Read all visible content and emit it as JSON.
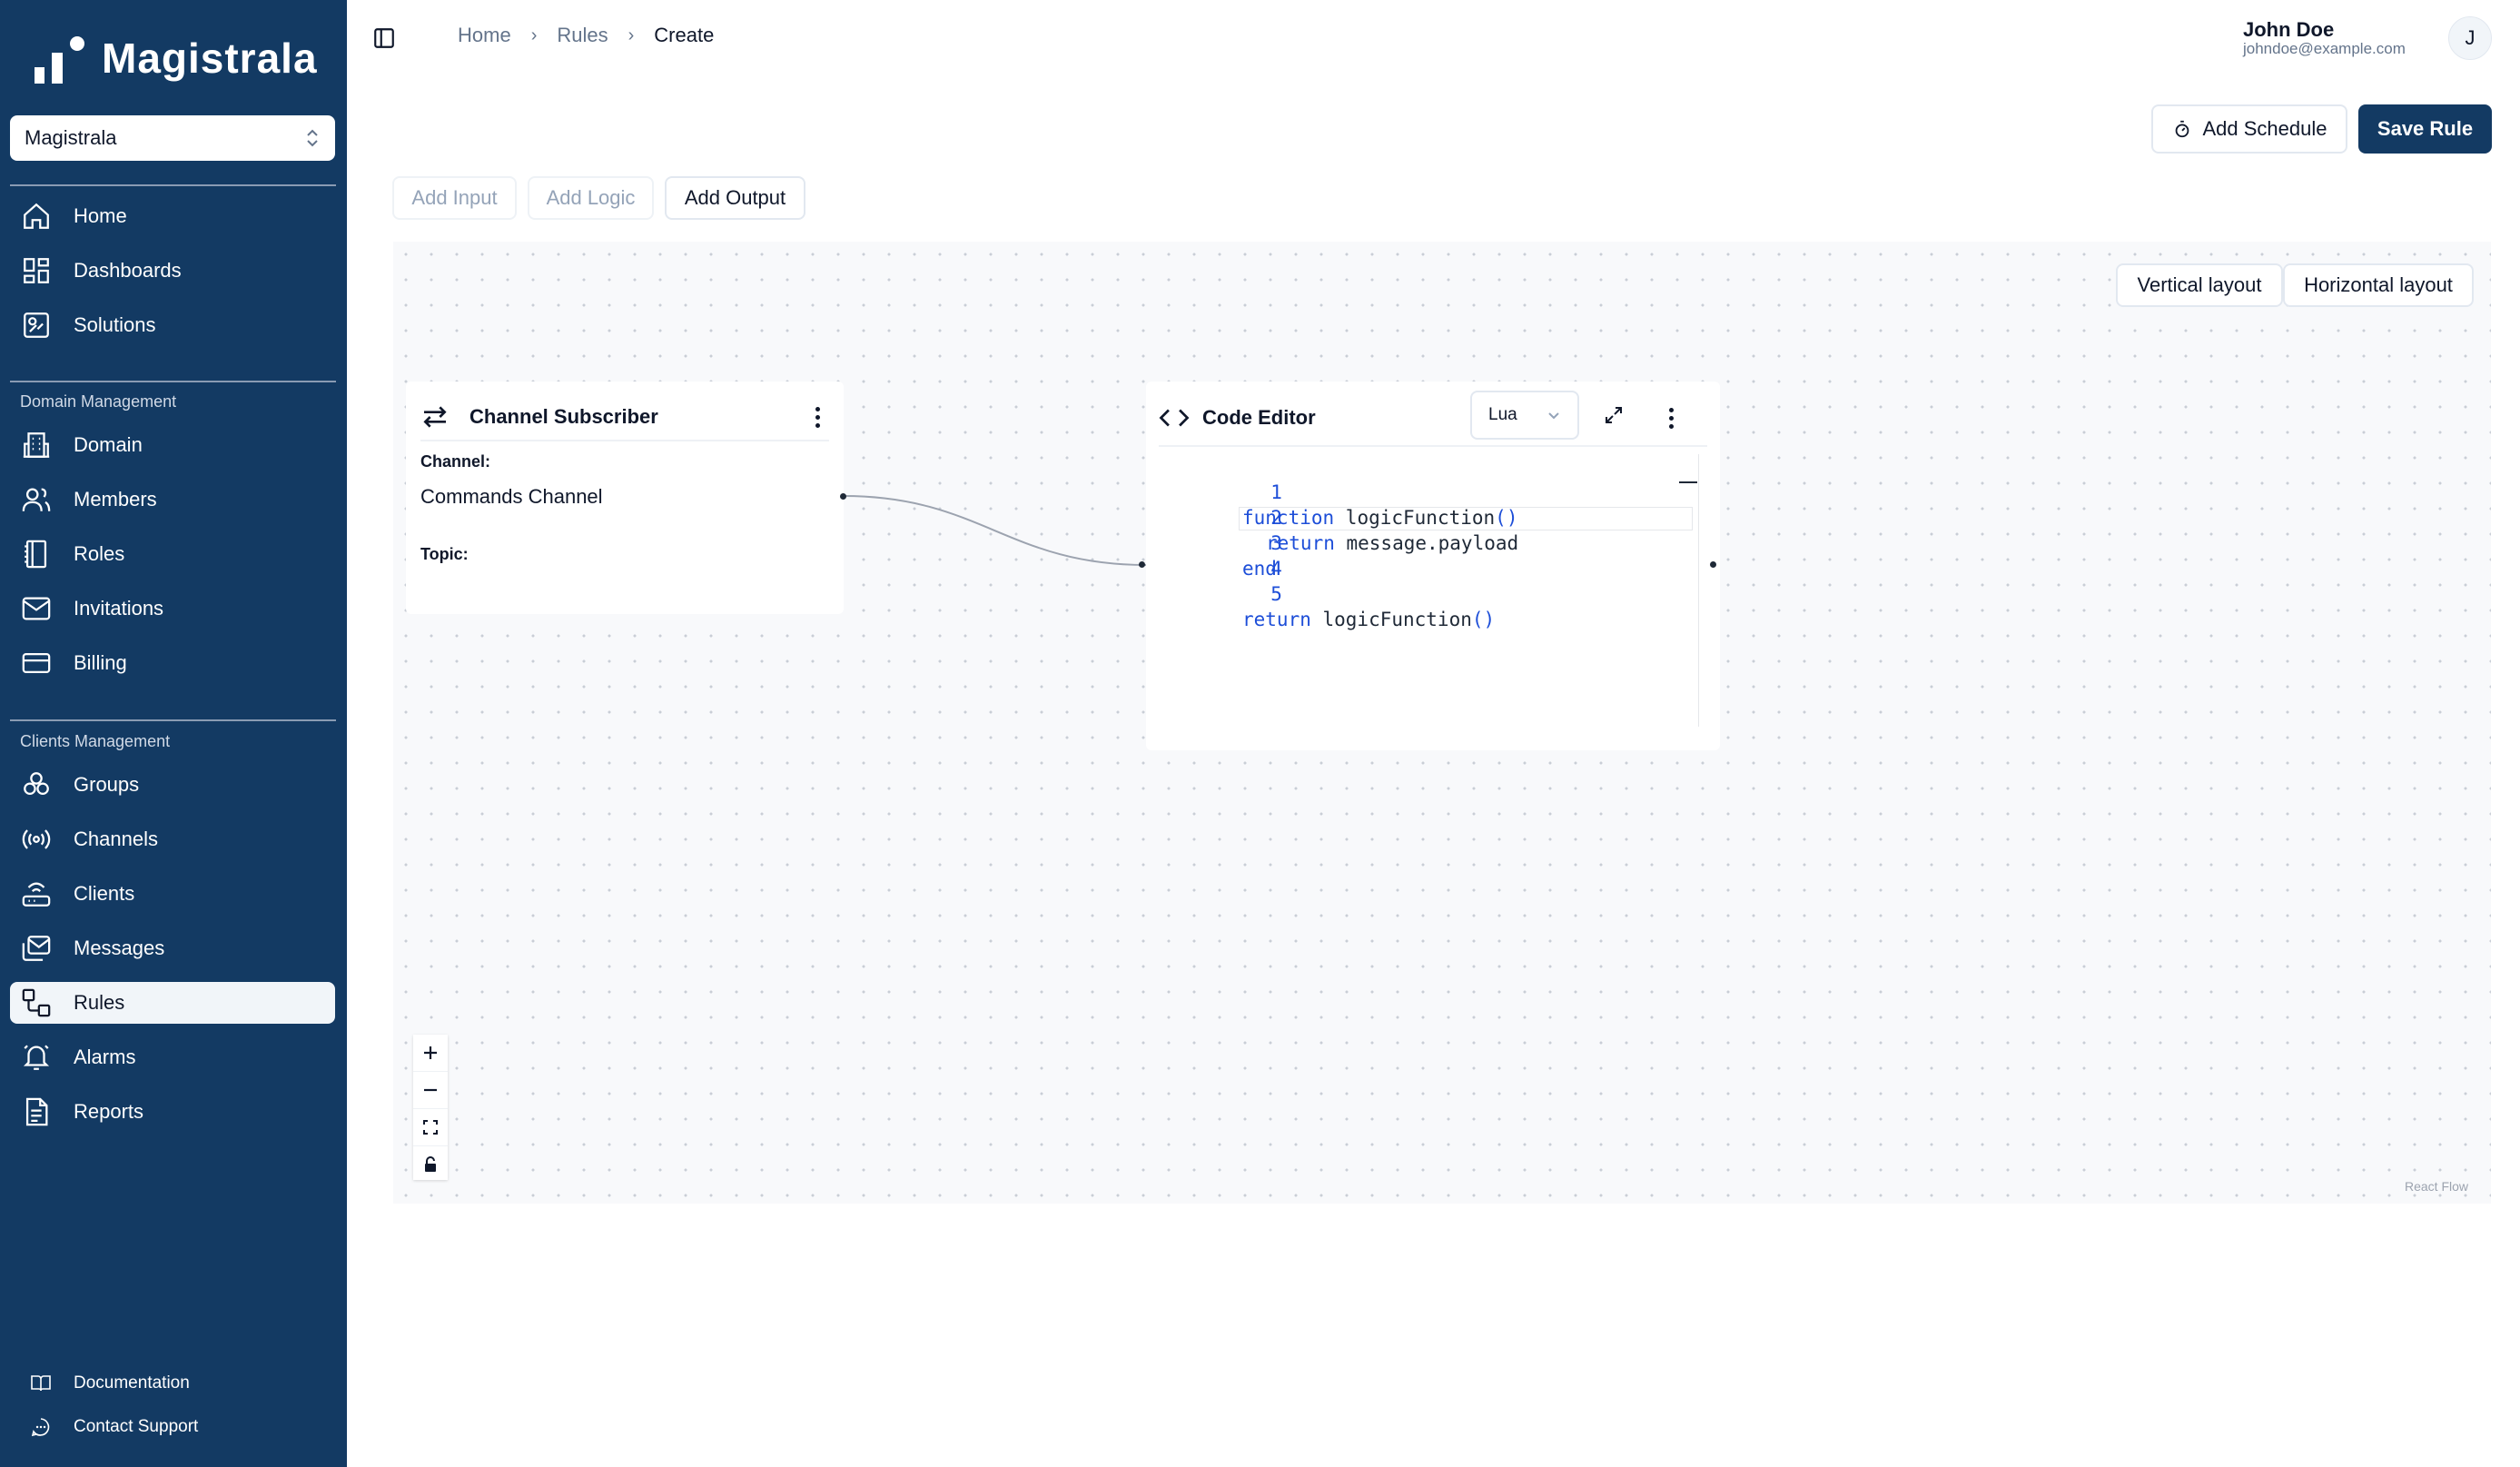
{
  "sidebar": {
    "brand": "Magistrala",
    "workspace": "Magistrala",
    "main_items": [
      {
        "label": "Home",
        "icon": "home-icon"
      },
      {
        "label": "Dashboards",
        "icon": "dashboard-icon"
      },
      {
        "label": "Solutions",
        "icon": "solutions-icon"
      }
    ],
    "domain_section": "Domain Management",
    "domain_items": [
      {
        "label": "Domain",
        "icon": "building-icon"
      },
      {
        "label": "Members",
        "icon": "users-icon"
      },
      {
        "label": "Roles",
        "icon": "book-icon"
      },
      {
        "label": "Invitations",
        "icon": "mail-icon"
      },
      {
        "label": "Billing",
        "icon": "credit-card-icon"
      }
    ],
    "clients_section": "Clients Management",
    "clients_items": [
      {
        "label": "Groups",
        "icon": "groups-icon"
      },
      {
        "label": "Channels",
        "icon": "broadcast-icon"
      },
      {
        "label": "Clients",
        "icon": "router-icon"
      },
      {
        "label": "Messages",
        "icon": "messages-icon"
      },
      {
        "label": "Rules",
        "icon": "workflow-icon",
        "active": true
      },
      {
        "label": "Alarms",
        "icon": "bell-icon"
      },
      {
        "label": "Reports",
        "icon": "report-icon"
      }
    ],
    "footer": [
      {
        "label": "Documentation",
        "icon": "book-open-icon"
      },
      {
        "label": "Contact Support",
        "icon": "chat-icon"
      }
    ]
  },
  "header": {
    "breadcrumb": [
      "Home",
      "Rules",
      "Create"
    ],
    "user": {
      "name": "John Doe",
      "email": "johndoe@example.com",
      "initial": "J"
    }
  },
  "toolbar": {
    "add_schedule": "Add Schedule",
    "save_rule": "Save Rule",
    "add_input": "Add Input",
    "add_logic": "Add Logic",
    "add_output": "Add Output"
  },
  "canvas": {
    "vertical_layout": "Vertical layout",
    "horizontal_layout": "Horizontal layout",
    "attribution": "React Flow"
  },
  "channel_node": {
    "title": "Channel Subscriber",
    "channel_label": "Channel:",
    "channel_value": "Commands Channel",
    "topic_label": "Topic:"
  },
  "code_node": {
    "title": "Code Editor",
    "language": "Lua",
    "lines": [
      {
        "num": "1",
        "kw1": "function",
        "rest": " logicFunction",
        "tail": "()"
      },
      {
        "num": "2",
        "kw1": "return",
        "rest": " message.payload",
        "tail": ""
      },
      {
        "num": "3",
        "kw1": "end",
        "rest": "",
        "tail": ""
      },
      {
        "num": "4",
        "kw1": "",
        "rest": "",
        "tail": ""
      },
      {
        "num": "5",
        "kw1": "return",
        "rest": " logicFunction",
        "tail": "()"
      }
    ]
  },
  "colors": {
    "sidebar": "#133a63",
    "primary": "#133a63",
    "code_keyword": "#1d4ed8"
  }
}
